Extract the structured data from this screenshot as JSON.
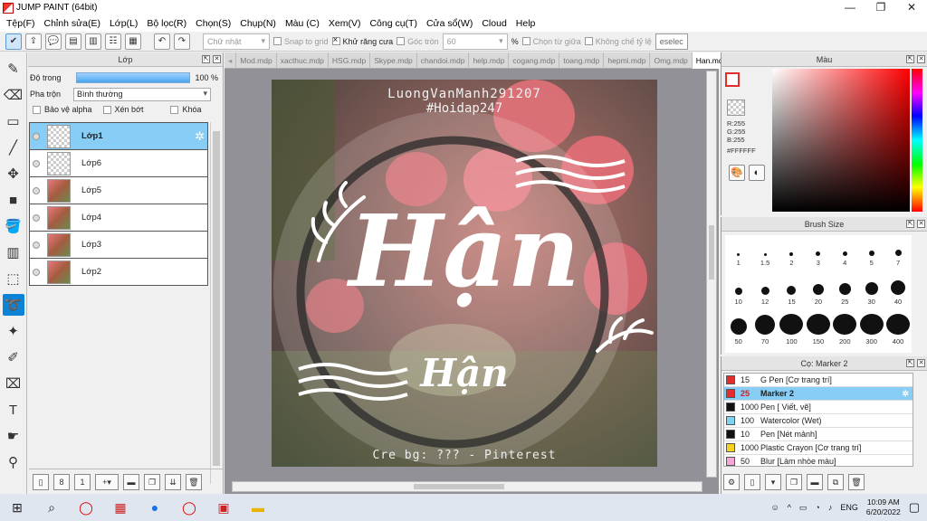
{
  "window": {
    "title": "JUMP PAINT (64bit)"
  },
  "menu": [
    "Tệp(F)",
    "Chỉnh sửa(E)",
    "Lớp(L)",
    "Bộ lọc(R)",
    "Chọn(S)",
    "Chụp(N)",
    "Màu (C)",
    "Xem(V)",
    "Công cụ(T)",
    "Cửa sổ(W)",
    "Cloud",
    "Help"
  ],
  "toolbar": {
    "shape_dropdown": "Chữ nhật",
    "snap_grid": "Snap to grid",
    "antialias": "Khử răng cưa",
    "corner": "Góc tròn",
    "corner_value": "60",
    "percent": "%",
    "from_center": "Chọn từ giữa",
    "no_ratio": "Không chế tỷ lệ",
    "deselect": "eselec"
  },
  "layer_panel": {
    "title": "Lớp",
    "opacity_label": "Độ trong",
    "opacity_value": "100 %",
    "opacity": 1.0,
    "blend_label": "Pha trộn",
    "blend_value": "Bình thường",
    "protect_alpha": "Bảo vệ alpha",
    "clip": "Xén bớt",
    "lock": "Khóa",
    "layers": [
      {
        "name": "Lớp1",
        "selected": true
      },
      {
        "name": "Lớp6",
        "selected": false
      },
      {
        "name": "Lớp5",
        "selected": false
      },
      {
        "name": "Lớp4",
        "selected": false
      },
      {
        "name": "Lớp3",
        "selected": false
      },
      {
        "name": "Lớp2",
        "selected": false
      }
    ]
  },
  "tabs": [
    "Mod.mdp",
    "xacthuc.mdp",
    "HSG.mdp",
    "Skype.mdp",
    "chandoi.mdp",
    "help.mdp",
    "cogang.mdp",
    "toang.mdp",
    "hepmi.mdp",
    "Omg.mdp",
    "Han.mdp"
  ],
  "active_tab": "Han.mdp",
  "artwork": {
    "line1": "LuongVanManh291207",
    "line2": "#Hoidap247",
    "big_text": "Hận",
    "small_text": "Hận",
    "credit": "Cre bg: ??? - Pinterest"
  },
  "color_panel": {
    "title": "Màu",
    "r": "R:255",
    "g": "G:255",
    "b": "B:255",
    "hex": "#FFFFFF",
    "accent": "#e32d2d"
  },
  "brush_panel": {
    "title": "Brush Size",
    "sizes": [
      "1",
      "1.5",
      "2",
      "3",
      "4",
      "5",
      "7",
      "10",
      "12",
      "15",
      "20",
      "25",
      "30",
      "40",
      "50",
      "70",
      "100",
      "150",
      "200",
      "300",
      "400"
    ]
  },
  "marker_panel": {
    "title": "Cọ: Marker 2",
    "items": [
      {
        "num": "15",
        "name": "G Pen [Cơ trang trí]",
        "color": "#e32d2d"
      },
      {
        "num": "25",
        "name": "Marker 2",
        "color": "#e32d2d",
        "selected": true
      },
      {
        "num": "1000",
        "name": "Pen [ Viết, vẽ]",
        "color": "#111111"
      },
      {
        "num": "100",
        "name": "Watercolor (Wet)",
        "color": "#7fd3f0"
      },
      {
        "num": "10",
        "name": "Pen [Nét mảnh]",
        "color": "#111111"
      },
      {
        "num": "1000",
        "name": "Plastic Crayon [Cơ trang trí]",
        "color": "#f2d31f"
      },
      {
        "num": "50",
        "name": "Blur [Làm nhòe màu]",
        "color": "#f4a6d8"
      }
    ]
  },
  "taskbar": {
    "lang": "ENG",
    "time": "10:09 AM",
    "date": "6/20/2022"
  }
}
